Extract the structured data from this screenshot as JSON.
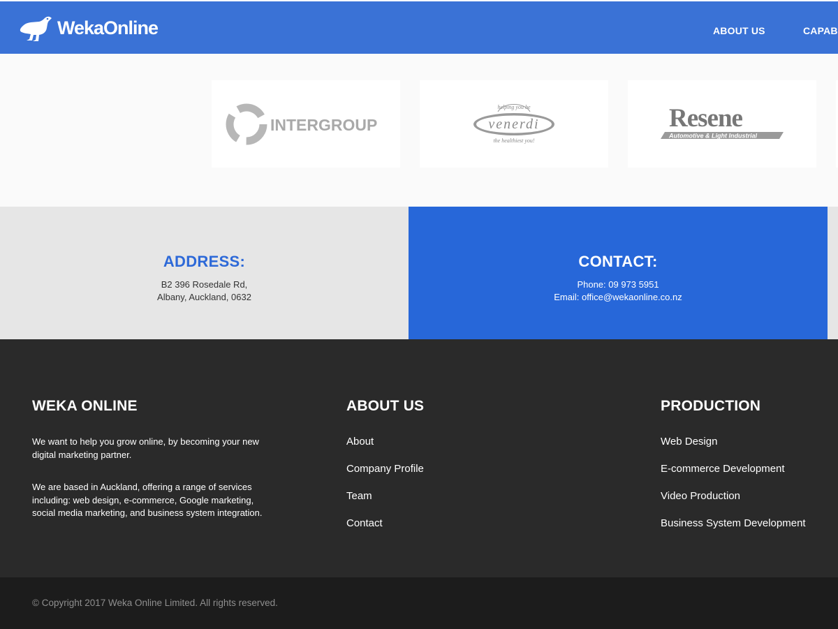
{
  "header": {
    "logo_text": "WekaOnline",
    "nav": [
      "ABOUT US",
      "CAPABI"
    ]
  },
  "clients": [
    {
      "name": "INTERGROUP",
      "icon": "intergroup-logo"
    },
    {
      "name": "venerdi",
      "tagline_top": "helping you be",
      "tagline_bottom": "the healthiest you!",
      "icon": "venerdi-logo"
    },
    {
      "name": "Resene",
      "tagline": "Automotive & Light Industrial",
      "icon": "resene-logo"
    }
  ],
  "address": {
    "title": "ADDRESS:",
    "line1": "B2 396 Rosedale Rd,",
    "line2": "Albany, Auckland, 0632"
  },
  "contact": {
    "title": "CONTACT:",
    "phone": "Phone: 09 973 5951",
    "email": "Email: office@wekaonline.co.nz"
  },
  "footer": {
    "col1": {
      "title": "WEKA ONLINE",
      "para1": "We want to help you grow online, by becoming your new digital marketing partner.",
      "para2": "We are based in Auckland, offering a range of services including: web design, e-commerce, Google marketing, social media marketing, and business system integration."
    },
    "col2": {
      "title": "ABOUT US",
      "links": [
        "About",
        "Company Profile",
        "Team",
        "Contact"
      ]
    },
    "col3": {
      "title": "PRODUCTION",
      "links": [
        "Web Design",
        "E-commerce Development",
        "Video Production",
        "Business System Development"
      ]
    },
    "copyright": "© Copyright 2017 Weka Online Limited. All rights reserved."
  },
  "colors": {
    "header_blue": "#3a72d6",
    "contact_blue": "#2767d9",
    "footer_dark": "#2a2a2a"
  }
}
